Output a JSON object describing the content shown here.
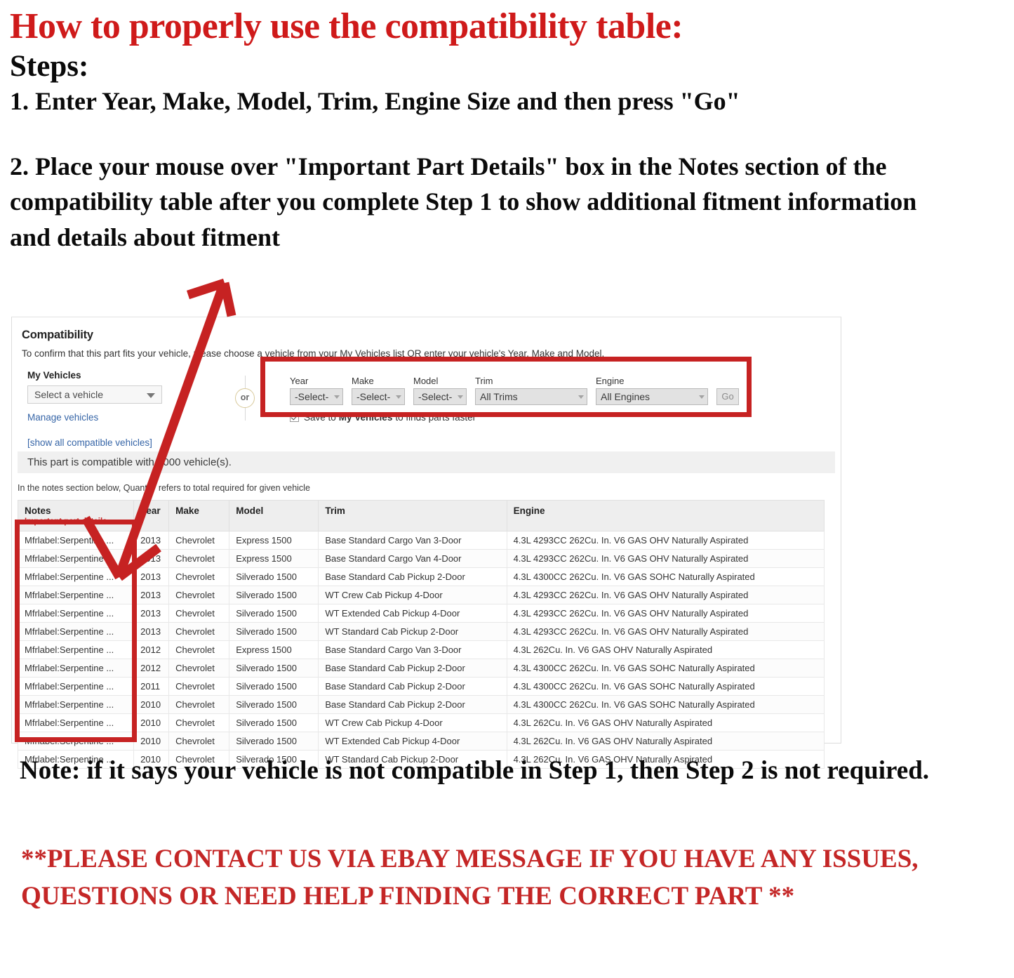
{
  "header": {
    "title": "How to properly use the compatibility table:",
    "steps_label": "Steps:",
    "step1": "1. Enter Year, Make, Model, Trim, Engine Size and then press \"Go\"",
    "step2": "2. Place your mouse over \"Important Part Details\" box in the Notes section of the compatibility table after you complete Step 1 to show additional fitment information and details about fitment"
  },
  "panel": {
    "title": "Compatibility",
    "subtitle": "To confirm that this part fits your vehicle, please choose a vehicle from your My Vehicles list OR enter your vehicle's Year, Make and Model.",
    "my_vehicles_label": "My Vehicles",
    "vehicle_select_value": "Select a vehicle",
    "manage_vehicles_link": "Manage vehicles",
    "show_all_link": "[show all compatible vehicles]",
    "or_label": "or",
    "fields": [
      {
        "label": "Year",
        "value": "-Select-",
        "size": "sm"
      },
      {
        "label": "Make",
        "value": "-Select-",
        "size": "sm"
      },
      {
        "label": "Model",
        "value": "-Select-",
        "size": "sm"
      },
      {
        "label": "Trim",
        "value": "All Trims",
        "size": "md"
      },
      {
        "label": "Engine",
        "value": "All Engines",
        "size": "md"
      }
    ],
    "go_label": "Go",
    "save_checkbox": {
      "checked": true,
      "prefix": "Save to",
      "bold": "My Vehicles",
      "suffix": "to finds parts faster"
    },
    "compat_count_text": "This part is compatible with 1000 vehicle(s).",
    "quantity_note": "In the notes section below, Quantity refers to total required for given vehicle"
  },
  "table": {
    "columns": [
      "Notes",
      "Year",
      "Make",
      "Model",
      "Trim",
      "Engine"
    ],
    "notes_subheader": "Important part details",
    "rows": [
      {
        "notes": "Mfrlabel:Serpentine ...",
        "year": "2013",
        "make": "Chevrolet",
        "model": "Express 1500",
        "trim": "Base Standard Cargo Van 3-Door",
        "engine": "4.3L 4293CC 262Cu. In. V6 GAS OHV Naturally Aspirated"
      },
      {
        "notes": "Mfrlabel:Serpentine ...",
        "year": "2013",
        "make": "Chevrolet",
        "model": "Express 1500",
        "trim": "Base Standard Cargo Van 4-Door",
        "engine": "4.3L 4293CC 262Cu. In. V6 GAS OHV Naturally Aspirated"
      },
      {
        "notes": "Mfrlabel:Serpentine ...",
        "year": "2013",
        "make": "Chevrolet",
        "model": "Silverado 1500",
        "trim": "Base Standard Cab Pickup 2-Door",
        "engine": "4.3L 4300CC 262Cu. In. V6 GAS SOHC Naturally Aspirated"
      },
      {
        "notes": "Mfrlabel:Serpentine ...",
        "year": "2013",
        "make": "Chevrolet",
        "model": "Silverado 1500",
        "trim": "WT Crew Cab Pickup 4-Door",
        "engine": "4.3L 4293CC 262Cu. In. V6 GAS OHV Naturally Aspirated"
      },
      {
        "notes": "Mfrlabel:Serpentine ...",
        "year": "2013",
        "make": "Chevrolet",
        "model": "Silverado 1500",
        "trim": "WT Extended Cab Pickup 4-Door",
        "engine": "4.3L 4293CC 262Cu. In. V6 GAS OHV Naturally Aspirated"
      },
      {
        "notes": "Mfrlabel:Serpentine ...",
        "year": "2013",
        "make": "Chevrolet",
        "model": "Silverado 1500",
        "trim": "WT Standard Cab Pickup 2-Door",
        "engine": "4.3L 4293CC 262Cu. In. V6 GAS OHV Naturally Aspirated"
      },
      {
        "notes": "Mfrlabel:Serpentine ...",
        "year": "2012",
        "make": "Chevrolet",
        "model": "Express 1500",
        "trim": "Base Standard Cargo Van 3-Door",
        "engine": "4.3L 262Cu. In. V6 GAS OHV Naturally Aspirated"
      },
      {
        "notes": "Mfrlabel:Serpentine ...",
        "year": "2012",
        "make": "Chevrolet",
        "model": "Silverado 1500",
        "trim": "Base Standard Cab Pickup 2-Door",
        "engine": "4.3L 4300CC 262Cu. In. V6 GAS SOHC Naturally Aspirated"
      },
      {
        "notes": "Mfrlabel:Serpentine ...",
        "year": "2011",
        "make": "Chevrolet",
        "model": "Silverado 1500",
        "trim": "Base Standard Cab Pickup 2-Door",
        "engine": "4.3L 4300CC 262Cu. In. V6 GAS SOHC Naturally Aspirated"
      },
      {
        "notes": "Mfrlabel:Serpentine ...",
        "year": "2010",
        "make": "Chevrolet",
        "model": "Silverado 1500",
        "trim": "Base Standard Cab Pickup 2-Door",
        "engine": "4.3L 4300CC 262Cu. In. V6 GAS SOHC Naturally Aspirated"
      },
      {
        "notes": "Mfrlabel:Serpentine ...",
        "year": "2010",
        "make": "Chevrolet",
        "model": "Silverado 1500",
        "trim": "WT Crew Cab Pickup 4-Door",
        "engine": "4.3L 262Cu. In. V6 GAS OHV Naturally Aspirated"
      },
      {
        "notes": "Mfrlabel:Serpentine ...",
        "year": "2010",
        "make": "Chevrolet",
        "model": "Silverado 1500",
        "trim": "WT Extended Cab Pickup 4-Door",
        "engine": "4.3L 262Cu. In. V6 GAS OHV Naturally Aspirated"
      },
      {
        "notes": "Mfrlabel:Serpentine ...",
        "year": "2010",
        "make": "Chevrolet",
        "model": "Silverado 1500",
        "trim": "WT Standard Cab Pickup 2-Door",
        "engine": "4.3L 262Cu. In. V6 GAS OHV Naturally Aspirated"
      }
    ]
  },
  "footer": {
    "note": "Note: if it says your vehicle is not compatible in Step 1, then Step 2 is not required.",
    "contact": "**PLEASE CONTACT US VIA EBAY MESSAGE IF YOU HAVE ANY ISSUES, QUESTIONS OR NEED HELP FINDING THE CORRECT PART **"
  },
  "colors": {
    "heading_red": "#CF1A1A",
    "highlight_red": "#C62222",
    "link_blue": "#3665A7",
    "important_red": "#C32B2B"
  }
}
